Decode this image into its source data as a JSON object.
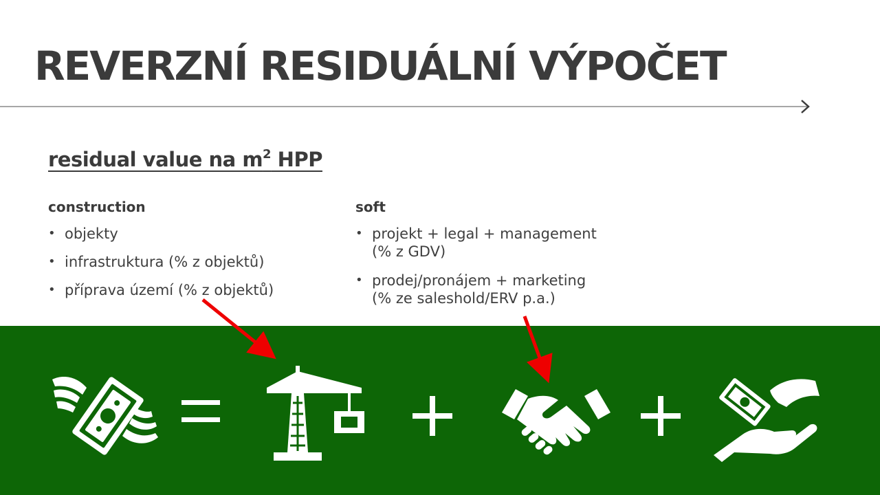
{
  "slide": {
    "title": "REVERZNÍ RESIDUÁLNÍ VÝPOČET",
    "subtitle_main": "residual value na m",
    "subtitle_sup": "2",
    "subtitle_tail": " HPP"
  },
  "columns": {
    "construction": {
      "heading": "construction",
      "items": [
        "objekty",
        "infrastruktura (% z objektů)",
        "příprava území (% z objektů)"
      ]
    },
    "soft": {
      "heading": "soft",
      "items": [
        {
          "line1": "projekt + legal + management",
          "line2": "(% z GDV)"
        },
        {
          "line1": "prodej/pronájem + marketing",
          "line2": "(% ze saleshold/ERV p.a.)"
        }
      ]
    }
  },
  "colors": {
    "band": "#0d6606",
    "arrows": "#ee0000",
    "text": "#3b3b3b",
    "icons": "#ffffff"
  },
  "equation": {
    "icons": [
      "flying-money-icon",
      "equals-icon",
      "crane-icon",
      "plus-icon",
      "handshake-icon",
      "plus-icon",
      "money-hand-icon"
    ]
  }
}
